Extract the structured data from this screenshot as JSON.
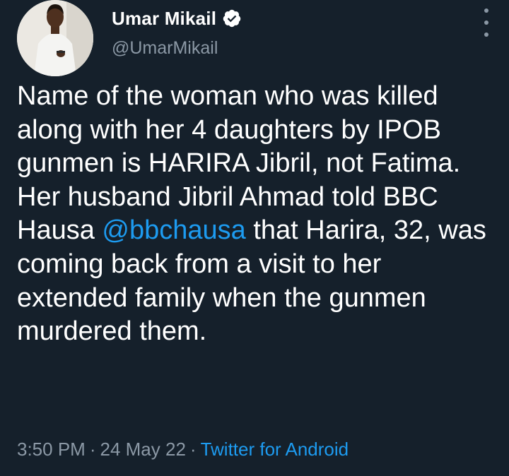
{
  "author": {
    "display_name": "Umar Mikail",
    "handle": "@UmarMikail",
    "verified_icon": "verified-badge-icon"
  },
  "tweet": {
    "text_part1": "Name of the woman who was killed along with her 4 daughters by IPOB gunmen is HARIRA Jibril, not Fatima. Her husband Jibril Ahmad told BBC Hausa ",
    "mention": "@bbchausa",
    "text_part2": " that Harira, 32, was coming back from a visit to her extended family when the gunmen murdered them."
  },
  "meta": {
    "time": "3:50 PM",
    "separator": "·",
    "date": "24 May 22",
    "source": "Twitter for Android"
  },
  "colors": {
    "background": "#15202b",
    "text": "#ffffff",
    "secondary": "#8b98a5",
    "link": "#1d9bf0"
  }
}
